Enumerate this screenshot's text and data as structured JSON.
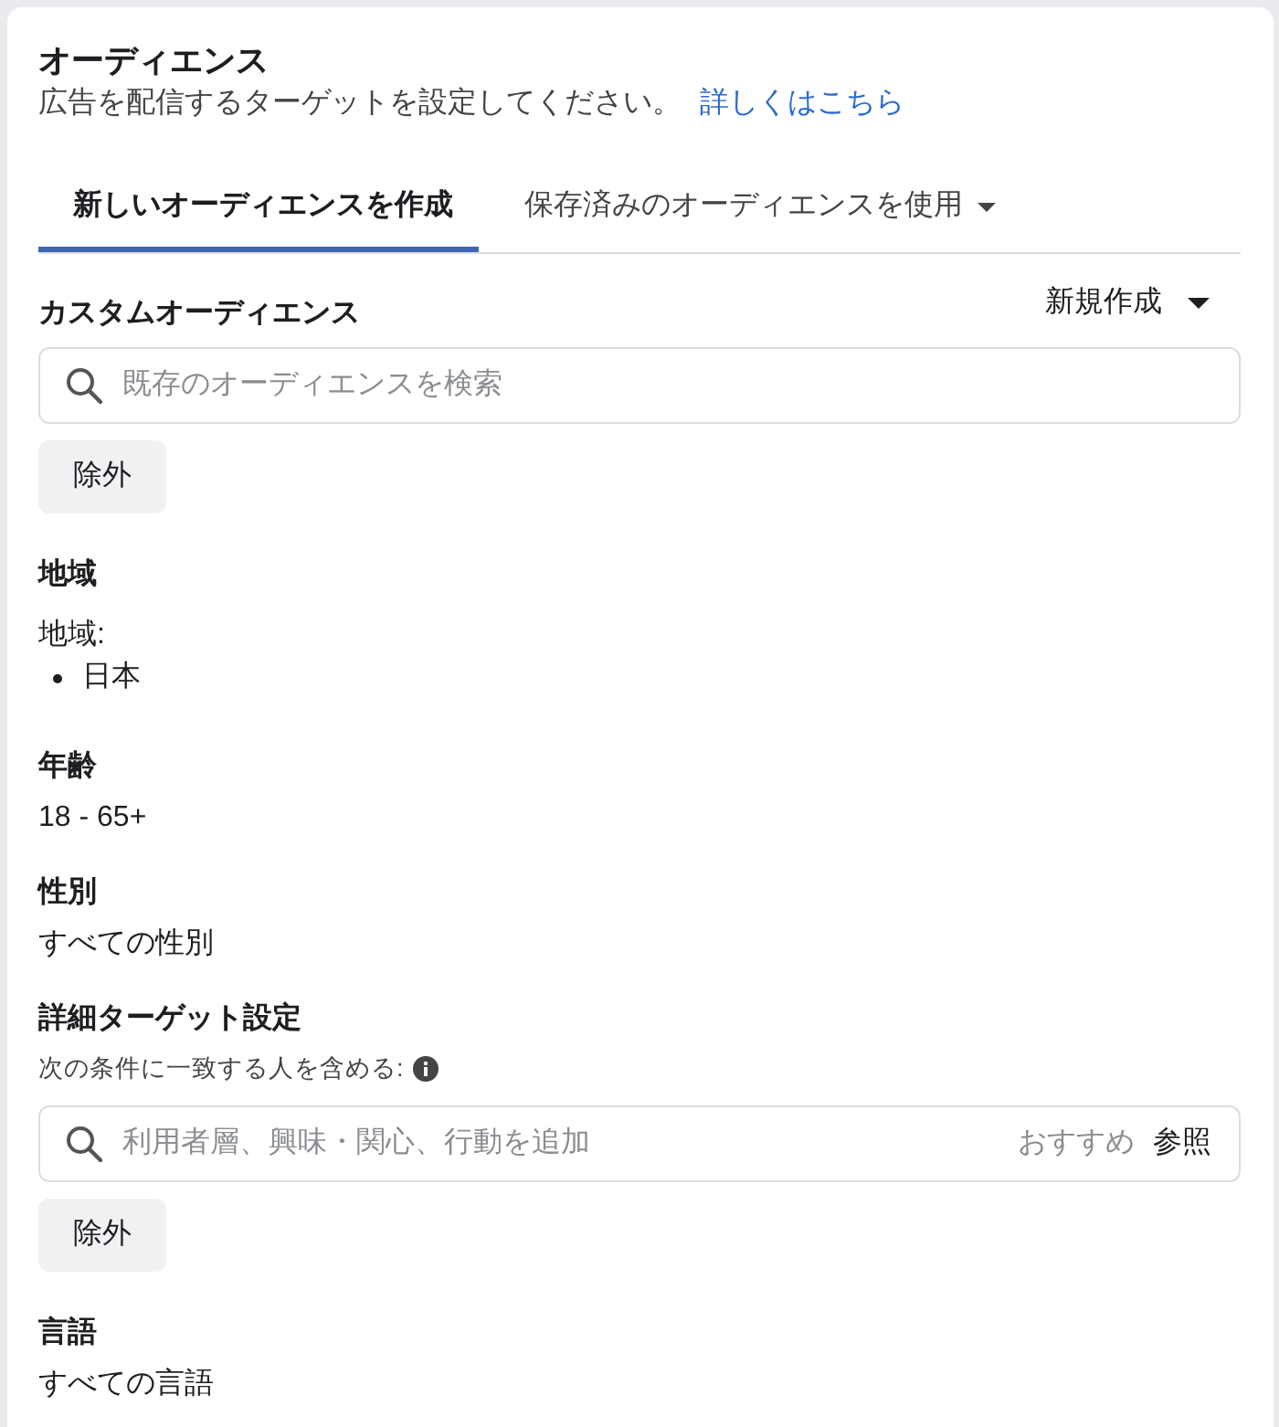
{
  "header": {
    "title": "オーディエンス",
    "description": "広告を配信するターゲットを設定してください。",
    "link": "詳しくはこちら"
  },
  "tabs": [
    {
      "label": "新しいオーディエンスを作成",
      "selected": true,
      "dropdown": false
    },
    {
      "label": "保存済みのオーディエンスを使用",
      "selected": false,
      "dropdown": true
    }
  ],
  "sections": [
    {
      "kind": "picker",
      "heading": "カスタムオーディエンス",
      "menu": "新規作成",
      "search": {
        "placeholder": "既存のオーディエンスを検索"
      },
      "exclude_button": "除外"
    },
    {
      "kind": "list",
      "heading": "地域",
      "label": "地域:",
      "items": [
        "日本"
      ]
    },
    {
      "kind": "value",
      "heading": "年齢",
      "value": "18 - 65+"
    },
    {
      "kind": "value",
      "heading": "性別",
      "value": "すべての性別"
    },
    {
      "kind": "picker",
      "heading": "詳細ターゲット設定",
      "hint": "次の条件に一致する人を含める:",
      "search": {
        "placeholder": "利用者層、興味・関心、行動を追加",
        "suggestions": "おすすめ",
        "browse": "参照"
      },
      "exclude_button": "除外"
    },
    {
      "kind": "value",
      "heading": "言語",
      "value": "すべての言語"
    }
  ]
}
